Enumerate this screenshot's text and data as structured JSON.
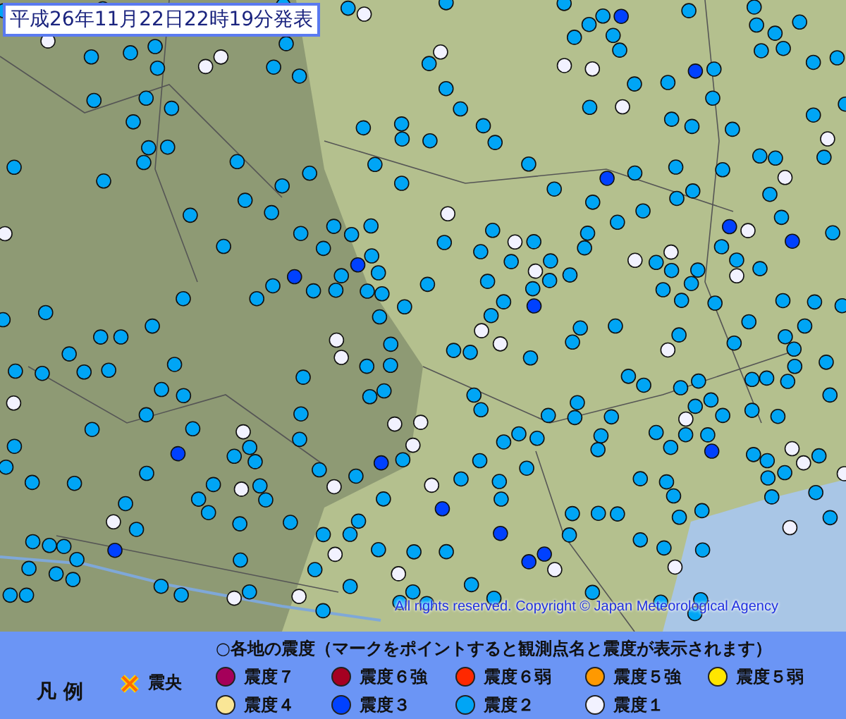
{
  "map": {
    "issued": "平成26年11月22日22時19分発表",
    "copyright": "All rights reserved. Copyright © Japan Meteorological Agency"
  },
  "legend": {
    "title": "凡 例",
    "epicenter": {
      "label": "震央"
    },
    "heading": "○各地の震度（マークをポイントすると観測点名と震度が表示されます）",
    "items": [
      {
        "label": "震度７",
        "color": "#a5005a"
      },
      {
        "label": "震度６強",
        "color": "#a50021"
      },
      {
        "label": "震度６弱",
        "color": "#ff2800"
      },
      {
        "label": "震度５強",
        "color": "#ff9900"
      },
      {
        "label": "震度５弱",
        "color": "#ffe600"
      },
      {
        "label": "震度４",
        "color": "#fae696"
      },
      {
        "label": "震度３",
        "color": "#0041ff"
      },
      {
        "label": "震度２",
        "color": "#00a5f5"
      },
      {
        "label": "震度１",
        "color": "#f2f2ff"
      }
    ]
  }
}
